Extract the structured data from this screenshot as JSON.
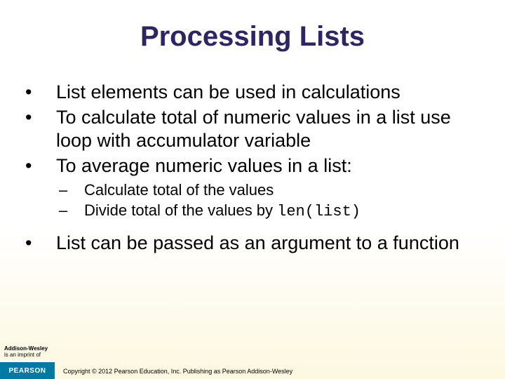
{
  "title": "Processing Lists",
  "bullets": {
    "b1": "List elements can be used in calculations",
    "b2": "To calculate total of numeric values in a list use loop with accumulator variable",
    "b3": "To average numeric values in a list:",
    "b3_1_pre": "Calculate total of the values",
    "b3_2_pre": "Divide total of the values by ",
    "b3_2_code": "len(list)",
    "b4": "List can be passed as an argument to a function"
  },
  "footer": {
    "imprint_line1": "Addison-Wesley",
    "imprint_line2": "is an imprint of",
    "logo": "PEARSON",
    "copyright": "Copyright © 2012 Pearson Education, Inc. Publishing as Pearson Addison-Wesley"
  }
}
